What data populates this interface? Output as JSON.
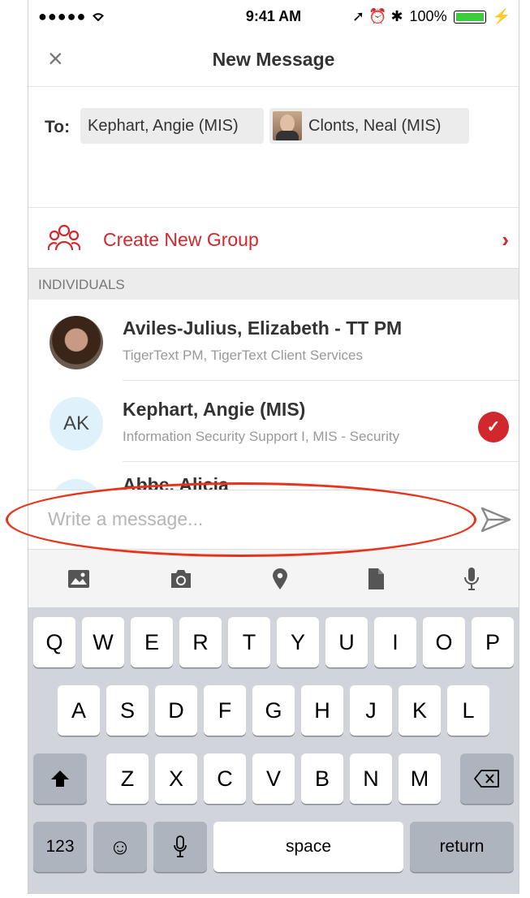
{
  "status_bar": {
    "carrier": "●●●●● ",
    "time": "9:41 AM",
    "icons": "➚ ⏰ ✱",
    "battery": "100%",
    "battery_color": "#3ccc3c"
  },
  "header": {
    "close_icon": "×",
    "title": "New Message"
  },
  "to_field": {
    "label": "To:",
    "recipients": [
      {
        "name": "Kephart, Angie (MIS)"
      },
      {
        "name": "Clonts, Neal (MIS)"
      }
    ]
  },
  "create_group": {
    "label": "Create New Group",
    "chevron": "›",
    "accent": "#d0282d"
  },
  "section_header": "INDIVIDUALS",
  "contacts": [
    {
      "name": "Aviles-Julius, Elizabeth - TT PM",
      "subtitle": "TigerText PM, TigerText Client Services",
      "avatar": "photo",
      "selected": false
    },
    {
      "name": "Kephart, Angie (MIS)",
      "subtitle": "Information Security Support I, MIS - Security",
      "initials": "AK",
      "avatar": "initials",
      "selected": true
    },
    {
      "name": "Abbe, Alicia",
      "subtitle": "",
      "avatar": "initials",
      "selected": false
    }
  ],
  "composer": {
    "placeholder": "Write a message..."
  },
  "attachments": [
    "image-icon",
    "camera-icon",
    "location-icon",
    "document-icon",
    "microphone-icon"
  ],
  "keyboard": {
    "row1": [
      "Q",
      "W",
      "E",
      "R",
      "T",
      "Y",
      "U",
      "I",
      "O",
      "P"
    ],
    "row2": [
      "A",
      "S",
      "D",
      "F",
      "G",
      "H",
      "J",
      "K",
      "L"
    ],
    "row3": [
      "Z",
      "X",
      "C",
      "V",
      "B",
      "N",
      "M"
    ],
    "numbers": "123",
    "emoji": "☺",
    "space": "space",
    "return": "return"
  },
  "annotation": {
    "color": "#e8341c"
  }
}
